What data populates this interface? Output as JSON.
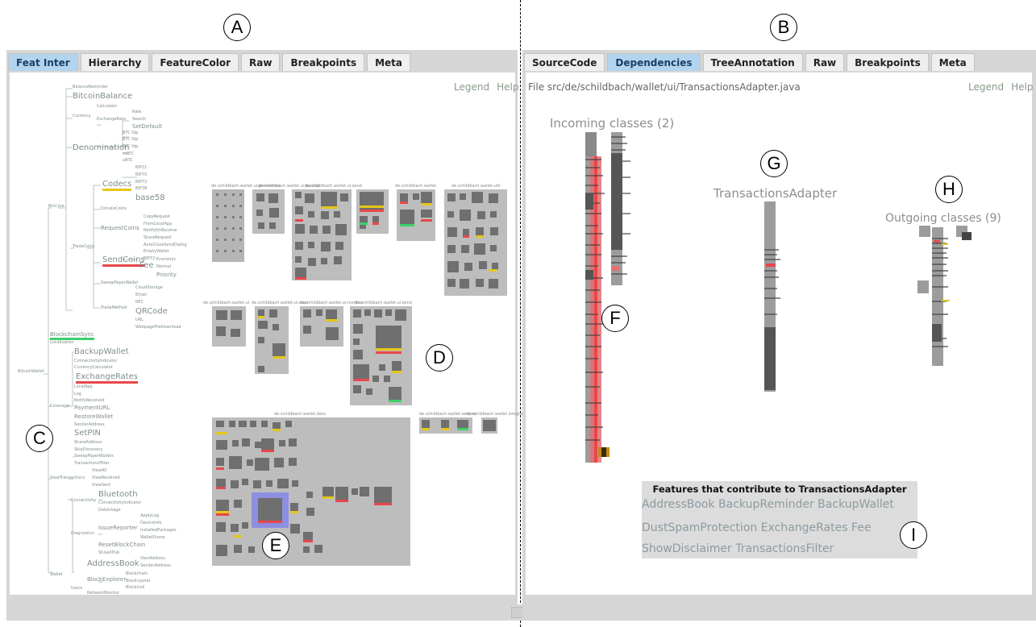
{
  "markers": {
    "a": "A",
    "b": "B",
    "c": "C",
    "d": "D",
    "e": "E",
    "f": "F",
    "g": "G",
    "h": "H",
    "i": "I"
  },
  "left": {
    "tabs": [
      "Feat Inter",
      "Hierarchy",
      "FeatureColor",
      "Raw",
      "Breakpoints",
      "Meta"
    ],
    "active_tab": 0,
    "links": {
      "legend": "Legend",
      "help": "Help"
    },
    "tree": {
      "root": "BitcoinWallet",
      "groups": {
        "btc": "BtcCore",
        "trade": "TradeCoins",
        "trade_method": "TradeMethod",
        "currency": "Currency",
        "exchange_rate": "ExchangeRate",
        "coverage": "Coverage",
        "view_tx": "ViewTransactions",
        "connectivity": "Connectivity",
        "diagnostics": "Diagnostics",
        "wallet": "Wallet",
        "users": "Users"
      },
      "labels": {
        "balance_reminder": "BalanceReminder",
        "bitcoin_balance": "BitcoinBalance",
        "calculator": "Calculator",
        "rate": "Rate",
        "search": "Search",
        "set_default": "SetDefault",
        "denomination": "Denomination",
        "btc_fdp1": "BTC fdp",
        "btc_fdp2": "BTC fdp",
        "btc_fdp3": "BTC fdp",
        "mbtc": "mBTC",
        "ubtc": "uBTC",
        "codecs": "Codecs",
        "bip21": "BIP21",
        "bip70": "BIP70",
        "bip72": "BIP72",
        "bip38": "BIP38",
        "base58": "base58",
        "donate": "DonateCoins",
        "request_coins": "RequestCoins",
        "copy_request": "CopyRequest",
        "from_local_app": "FromLocalApp",
        "notify_on_receive": "NotifyOnReceive",
        "share_request": "ShareRequest",
        "auto_close": "AutoCloseSendDialog",
        "empty_wallet": "EmptyWallet",
        "bip72b": "BIP72",
        "send_coins": "SendCoins",
        "fee": "Fee",
        "economic": "Economic",
        "normal": "Normal",
        "priority": "Priority",
        "sweep_paper": "SweepPaperWallet",
        "cloud_storage": "CloudStorage",
        "email": "Email",
        "nfc": "NFC",
        "qrcode": "QRCode",
        "url": "URL",
        "webpage": "WebpageFileDownload",
        "blockchain_sync": "BlockchainSync",
        "localisation": "Localisation",
        "backup_wallet": "BackupWallet",
        "connectivity_indicator": "ConnectivityIndicator",
        "currency_calculator": "CurrencyCalculator",
        "exchange_rates": "ExchangeRates",
        "local_app": "LocalApp",
        "log": "Log",
        "notify_received": "NotifyReceived",
        "payment_url": "PaymentURL",
        "restore_wallet": "RestoreWallet",
        "sender_address": "SenderAddress",
        "set_pin": "SetPIN",
        "share_address": "ShareAddress",
        "skip_discovery": "SkipDiscovery",
        "sweep_paper_wallets": "SweepPaperWallets",
        "transactions_filter": "TransactionsFilter",
        "view_all": "ViewAll",
        "view_received": "ViewReceived",
        "view_sent": "ViewSent",
        "bluetooth": "Bluetooth",
        "connectivity_indicator2": "ConnectivityIndicator",
        "data_usage": "DataUsage",
        "apply_log": "ApplyLog",
        "device_info": "DeviceInfo",
        "installed_packages": "InstalledPackages",
        "wallet_dump": "WalletDump",
        "issue_reporter": "IssueReporter",
        "reset_blockchain": "ResetBlockChain",
        "show_xpub": "ShowXPub",
        "address_book": "AddressBook",
        "own_address": "OwnAddress",
        "sender_addresses": "SenderAddress",
        "block_explorer": "BlockExplorer",
        "blockchain": "Blockchain",
        "blockcypher": "Blockcypher",
        "blocktrail": "Blocktrail",
        "network_monitor": "NetworkMonitor"
      }
    },
    "packages": {
      "p1": "de.schildbach.wallet.ui.preference",
      "p2": "de.schildbach.wallet.ui.backup",
      "p3": "de.schildbach.wallet.ui.send",
      "p4": "de.schildbach.wallet",
      "p5": "de.schildbach.wallet.util",
      "p6": "de.schildbach.wallet.ui",
      "p7": "de.schildbach.wallet.ui.scan",
      "p8": "de.schildbach.wallet.ui.monitor",
      "p9": "de.schildbach.wallet.ui.send",
      "p10": "de.schildbach.wallet.data",
      "p11": "de.schildbach.wallet.service",
      "p12": "de.schildbach.wallet.integration.android"
    }
  },
  "right": {
    "tabs": [
      "SourceCode",
      "Dependencies",
      "TreeAnnotation",
      "Raw",
      "Breakpoints",
      "Meta"
    ],
    "active_tab": 1,
    "file_label": "File src/de/schildbach/wallet/ui/TransactionsAdapter.java",
    "links": {
      "legend": "Legend",
      "help": "Help"
    },
    "incoming_title": "Incoming classes (2)",
    "center_title": "TransactionsAdapter",
    "outgoing_title": "Outgoing classes (9)",
    "features_heading": "Features that contribute to TransactionsAdapter",
    "features_lines": [
      "AddressBook BackupReminder BackupWallet",
      "DustSpamProtection ExchangeRates Fee",
      "ShowDisclaimer TransactionsFilter"
    ]
  },
  "colors": {
    "active_tab": "#b3d4ef",
    "pane_bg": "#d6d6d6",
    "highlight_red": "#e8474b",
    "highlight_yellow": "#e6c619",
    "highlight_green": "#3fd06b",
    "selection": "#8d8fe0"
  }
}
